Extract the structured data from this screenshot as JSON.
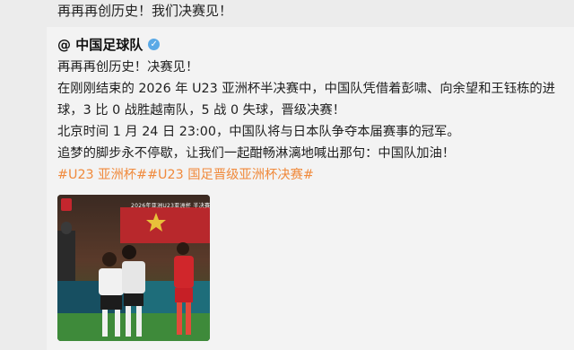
{
  "header": {
    "title": "再再再创历史！我们决赛见！"
  },
  "post": {
    "author": "@ 中国足球队",
    "verified_icon": "verified-badge-icon",
    "lines": [
      "再再再创历史！决赛见！",
      "在刚刚结束的 2026 年 U23 亚洲杯半决赛中，中国队凭借着彭啸、向余望和王钰栋的进",
      "球，3 比 0 战胜越南队，5 战 0 失球，晋级决赛！",
      "北京时间 1 月 24 日 23:00，中国队将与日本队争夺本届赛事的冠军。",
      "追梦的脚步永不停歇，让我们一起酣畅淋漓地喊出那句：中国队加油！"
    ],
    "tags": [
      "#U23 亚洲杯#",
      "#U23 国足晋级亚洲杯决赛#"
    ],
    "image_caption": "2026年亚洲U23亚洲杯 半决赛",
    "tag_color": "#f08a3c"
  }
}
